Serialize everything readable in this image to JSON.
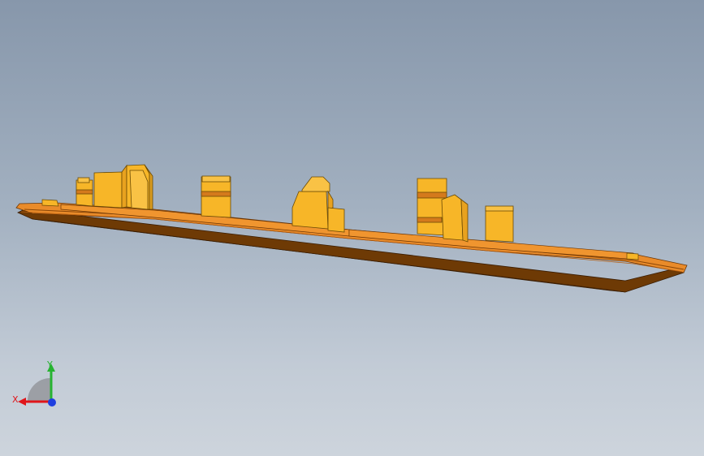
{
  "viewport": {
    "background_top": "#8797ab",
    "background_bottom": "#cdd4dc"
  },
  "model": {
    "part_color_base": "#c86f1a",
    "part_color_side": "#6e3a05",
    "part_color_features": "#f7b628"
  },
  "triad": {
    "x_label": "X",
    "y_label": "Y",
    "x_color": "#e0151a",
    "y_color": "#27b331",
    "z_color": "#1f3fe0",
    "icons": [
      "x-axis-arrow-icon",
      "y-axis-arrow-icon",
      "z-axis-dot-icon"
    ]
  }
}
